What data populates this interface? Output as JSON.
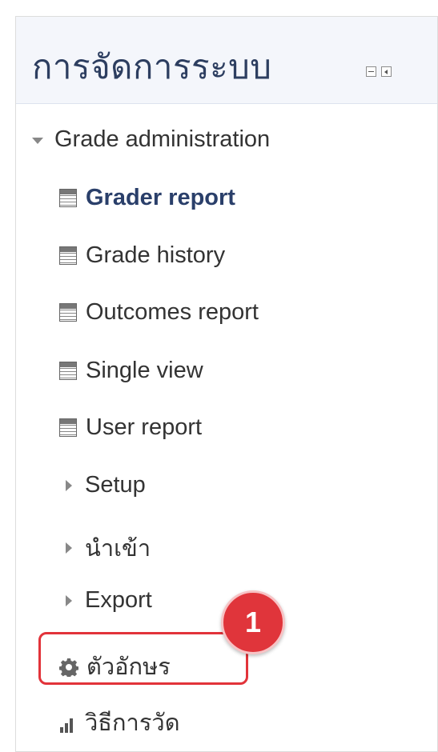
{
  "block": {
    "title": "การจัดการระบบ",
    "hide_icon": "minus-square-icon",
    "dock_icon": "dock-left-icon"
  },
  "nav": {
    "section_label": "Grade administration",
    "reports": [
      {
        "label": "Grader report",
        "active": true
      },
      {
        "label": "Grade history"
      },
      {
        "label": "Outcomes report"
      },
      {
        "label": "Single view"
      },
      {
        "label": "User report"
      }
    ],
    "collapsed": [
      {
        "label": "Setup"
      },
      {
        "label": "นำเข้า"
      },
      {
        "label": "Export"
      }
    ],
    "letters_label": "ตัวอักษร",
    "scales_label": "วิธีการวัด"
  },
  "annotation": {
    "badge_number": "1",
    "highlight_color": "#e2333a"
  },
  "colors": {
    "header_bg": "#f4f6fb",
    "title": "#2d3e60",
    "active_link": "#2a3f6a"
  }
}
